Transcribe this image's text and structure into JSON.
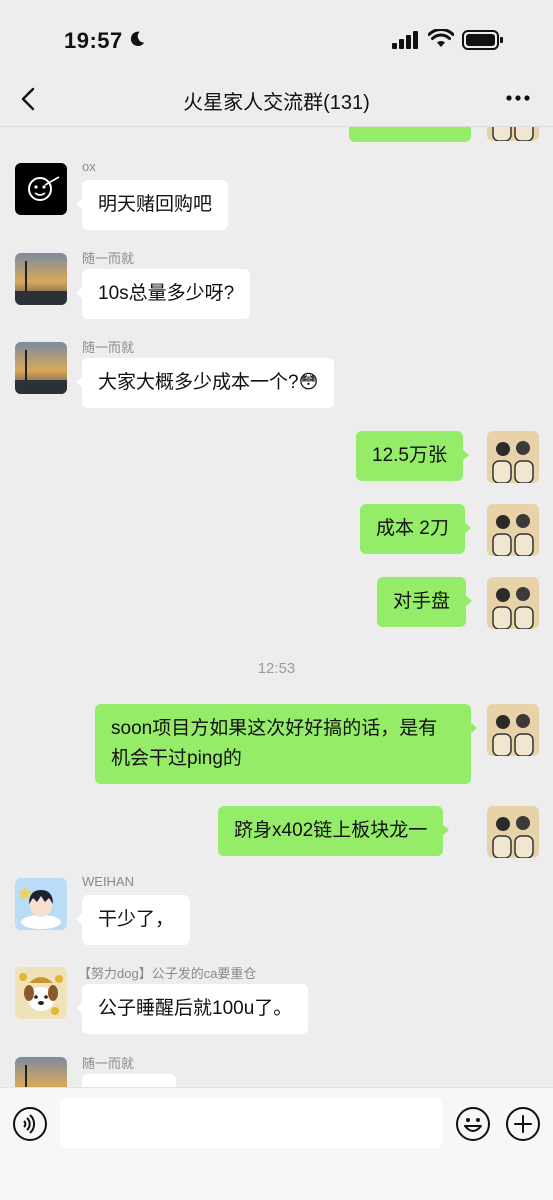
{
  "status": {
    "time": "19:57"
  },
  "nav": {
    "title": "火星家人交流群(131)"
  },
  "colors": {
    "outgoing_bubble": "#95ec69",
    "incoming_bubble": "#ffffff",
    "background": "#ededed"
  },
  "messages": [
    {
      "sender": "ox",
      "text": "明天赌回购吧"
    },
    {
      "sender": "随一而就",
      "text": "10s总量多少呀?"
    },
    {
      "sender": "随一而就",
      "text": "大家大概多少成本一个?",
      "emoji": "😳"
    },
    {
      "text": "12.5万张"
    },
    {
      "text": "成本 2刀"
    },
    {
      "text": "对手盘"
    },
    {
      "timestamp": "12:53"
    },
    {
      "text": "soon项目方如果这次好好搞的话，是有机会干过ping的"
    },
    {
      "text": "跻身x402链上板块龙一"
    },
    {
      "sender": "WEIHAN",
      "text": "干少了，"
    },
    {
      "sender": "【努力dog】公子发的ca要重仓",
      "text": "公子睡醒后就100u了。"
    },
    {
      "sender": "随一而就"
    }
  ]
}
